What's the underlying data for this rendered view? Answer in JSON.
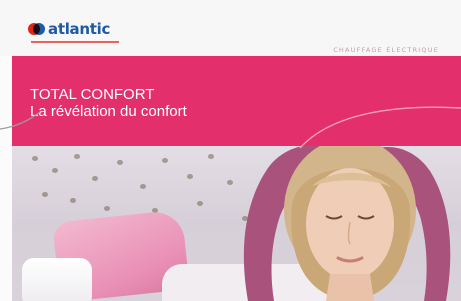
{
  "brand": {
    "name": "atlantic",
    "colors": {
      "red": "#e2231a",
      "blue": "#1f5aa6"
    }
  },
  "header": {
    "category": "CHAUFFAGE ÉLECTRIQUE"
  },
  "banner": {
    "title": "TOTAL CONFORT",
    "subtitle": "La révélation du confort",
    "color": "#e3306d"
  },
  "photo": {
    "icon": "relaxing-woman-photo"
  }
}
